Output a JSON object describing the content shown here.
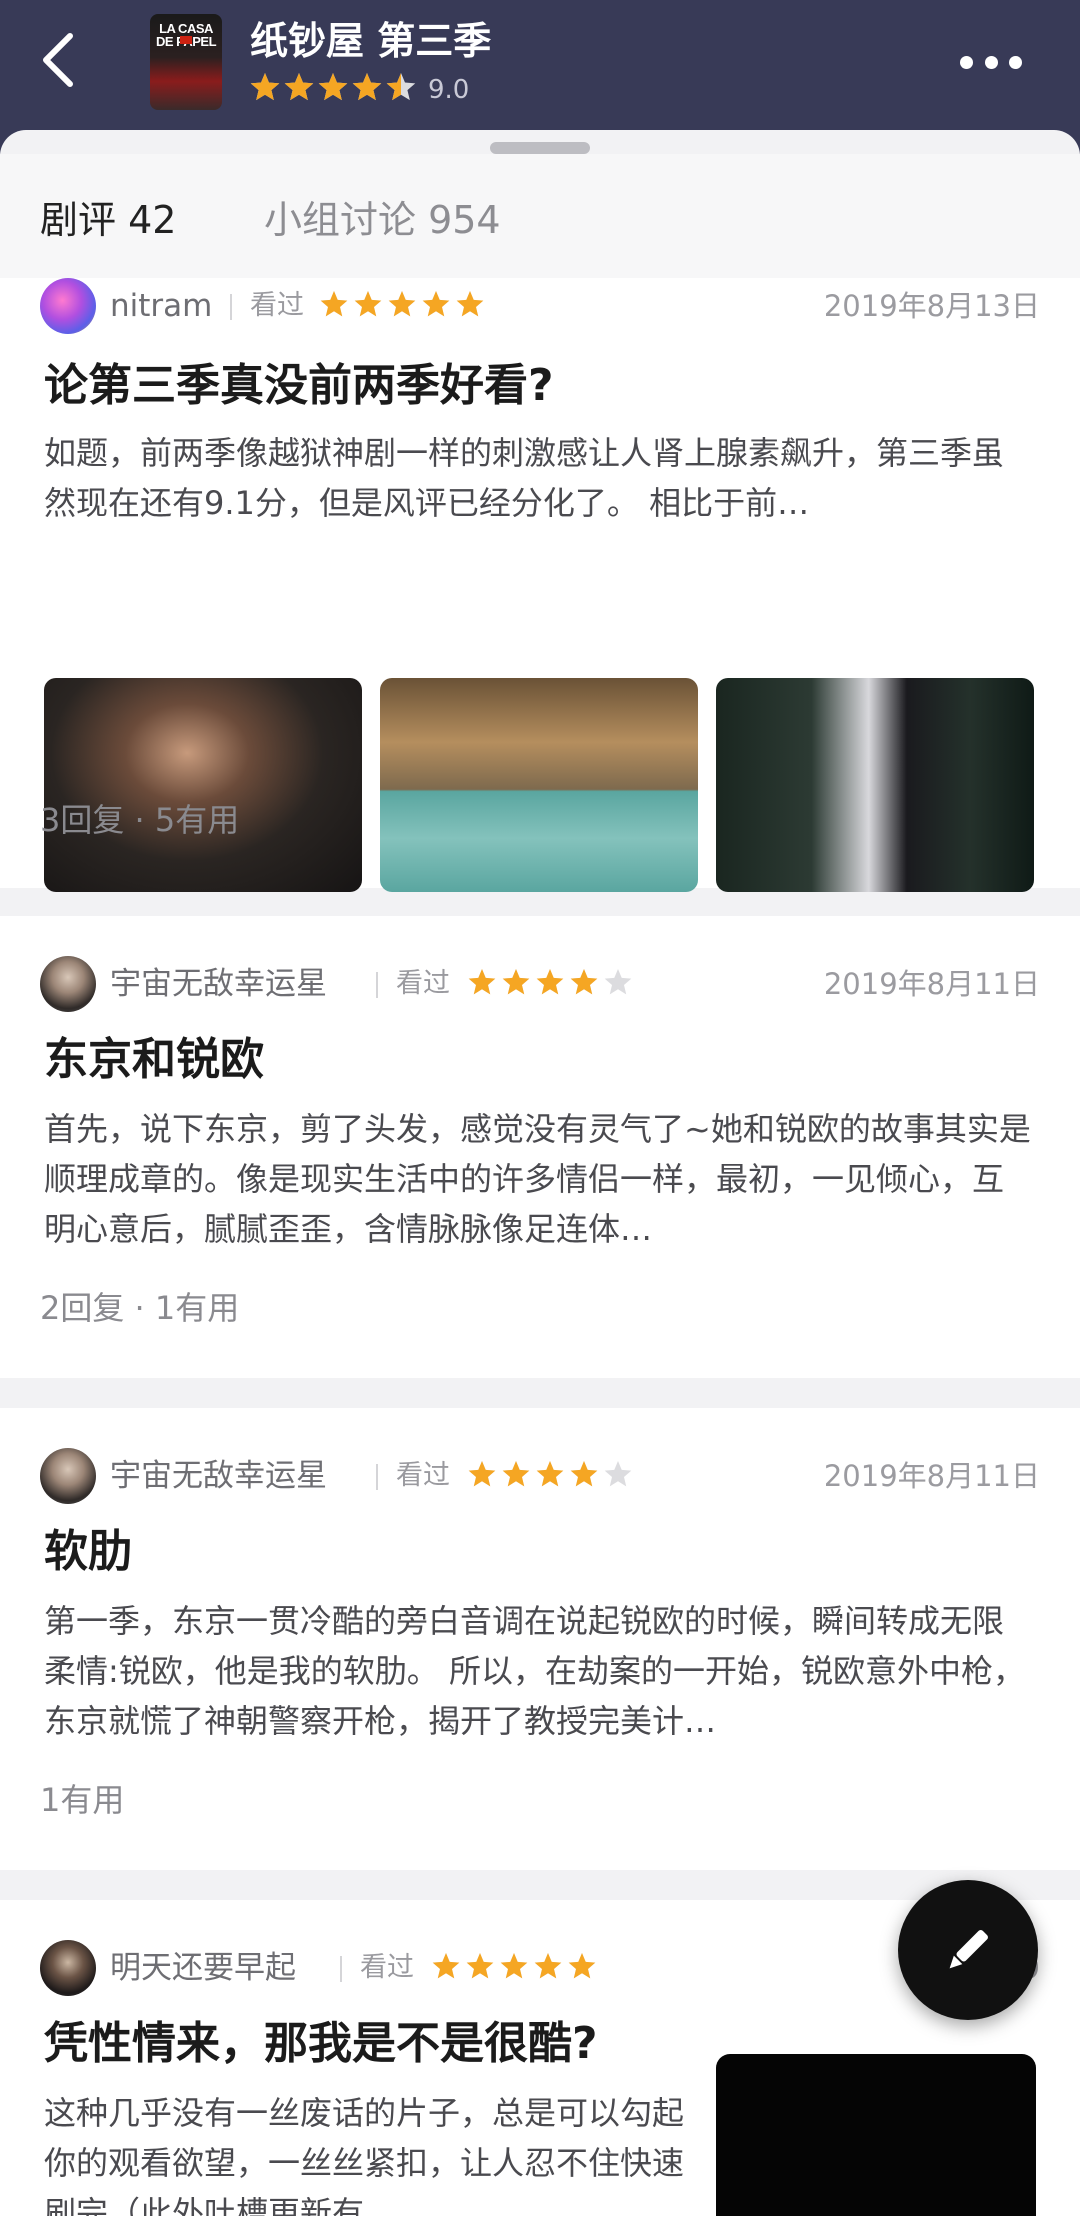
{
  "header": {
    "title": "纸钞屋 第三季",
    "rating": "9.0",
    "stars": 4.5,
    "poster_text": "LA CASA DE PAPEL"
  },
  "tabs": [
    {
      "label": "剧评 42",
      "active": true
    },
    {
      "label": "小组讨论 954",
      "active": false
    }
  ],
  "watched_label": "看过",
  "reviews": [
    {
      "user": "nitram",
      "stars": 5,
      "date": "2019年8月13日",
      "title": "论第三季真没前两季好看?",
      "excerpt": "如题，前两季像越狱神剧一样的刺激感让人肾上腺素飙升，第三季虽然现在还有9.1分，但是风评已经分化了。 相比于前…",
      "stats": "3回复 · 5有用"
    },
    {
      "user": "宇宙无敌幸运星",
      "stars": 4,
      "date": "2019年8月11日",
      "title": "东京和锐欧",
      "excerpt": "首先，说下东京，剪了头发，感觉没有灵气了~她和锐欧的故事其实是顺理成章的。像是现实生活中的许多情侣一样，最初，一见倾心，互明心意后，腻腻歪歪，含情脉脉像足连体…",
      "stats": "2回复 · 1有用"
    },
    {
      "user": "宇宙无敌幸运星",
      "stars": 4,
      "date": "2019年8月11日",
      "title": "软肋",
      "excerpt": "第一季，东京一贯冷酷的旁白音调在说起锐欧的时候，瞬间转成无限柔情:锐欧，他是我的软肋。 所以，在劫案的一开始，锐欧意外中枪，东京就慌了神朝警察开枪，揭开了教授完美计…",
      "stats": "1有用"
    },
    {
      "user": "明天还要早起",
      "stars": 5,
      "date": "2019",
      "title": "凭性情来，那我是不是很酷?",
      "excerpt": "这种几乎没有一丝废话的片子，总是可以勾起你的观看欲望，一丝丝紧扣，让人忍不住快速刷完（此外吐槽更新有…"
    }
  ],
  "colors": {
    "header_bg": "#383a57",
    "star_active": "#f5a623",
    "star_inactive": "#dcdcdf",
    "fab_bg": "#111111"
  },
  "icons": {
    "back": "chevron-left-icon",
    "more": "more-dots-icon",
    "fab": "pencil-icon"
  }
}
